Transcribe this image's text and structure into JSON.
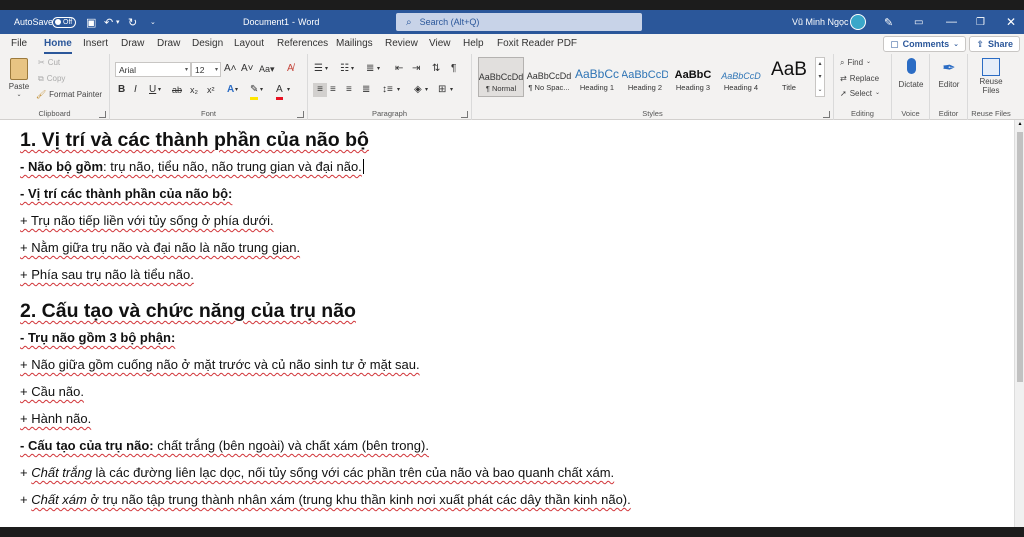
{
  "titlebar": {
    "autosave_label": "AutoSave",
    "autosave_state": "Off",
    "document_title": "Document1",
    "separator": "-",
    "app_name": "Word",
    "search_placeholder": "Search (Alt+Q)",
    "user_name": "Vũ Minh Ngọc"
  },
  "menu": {
    "tabs": [
      "File",
      "Home",
      "Insert",
      "Draw",
      "Draw",
      "Design",
      "Layout",
      "References",
      "Mailings",
      "Review",
      "View",
      "Help",
      "Foxit Reader PDF"
    ],
    "active": "Home",
    "comments_label": "Comments",
    "share_label": "Share"
  },
  "ribbon": {
    "clipboard": {
      "paste": "Paste",
      "cut": "Cut",
      "copy": "Copy",
      "format_painter": "Format Painter",
      "label": "Clipboard"
    },
    "font": {
      "name": "Arial",
      "size": "12",
      "case": "Aa",
      "label": "Font"
    },
    "paragraph": {
      "label": "Paragraph"
    },
    "styles": {
      "items": [
        {
          "sample": "AaBbCcDd",
          "name": "¶ Normal"
        },
        {
          "sample": "AaBbCcDd",
          "name": "¶ No Spac..."
        },
        {
          "sample": "AaBbCc",
          "name": "Heading 1"
        },
        {
          "sample": "AaBbCcD",
          "name": "Heading 2"
        },
        {
          "sample": "AaBbC",
          "name": "Heading 3"
        },
        {
          "sample": "AaBbCcD",
          "name": "Heading 4"
        },
        {
          "sample": "AaB",
          "name": "Title"
        }
      ],
      "label": "Styles"
    },
    "editing": {
      "find": "Find",
      "replace": "Replace",
      "select": "Select",
      "label": "Editing"
    },
    "voice": {
      "dictate": "Dictate",
      "label": "Voice"
    },
    "editor": {
      "editor": "Editor",
      "label": "Editor"
    },
    "reuse": {
      "line1": "Reuse",
      "line2": "Files",
      "label": "Reuse Files"
    }
  },
  "document": {
    "h1_a": "1. Vị trí và các thành phần của não bộ",
    "p1_lead": "- Não bộ gồm",
    "p1_rest": ": trụ não, tiểu não, não trung gian và đại não.",
    "p2": "- Vị trí các thành phần của não bộ:",
    "p3": "+ Trụ não tiếp liền với tủy sống ở phía dưới.",
    "p4": "+ Nằm giữa trụ não và đại não là não trung gian.",
    "p5": "+ Phía sau trụ não là tiểu não.",
    "h1_b": "2. Cấu tạo và chức năng của trụ não",
    "p6": "- Trụ não gồm 3 bộ phận:",
    "p7": "+ Não giữa gồm cuống não ở mặt trước và củ não sinh tư ở mặt sau.",
    "p8": "+ Cầu não.",
    "p9": "+ Hành não.",
    "p10_lead": "- Cấu tạo của trụ não:",
    "p10_rest": " chất trắng (bên ngoài) và chất xám (bên trong).",
    "p11_plus": "+ ",
    "p11_term": "Chất trắng",
    "p11_rest": " là các đường liên lạc dọc, nối tủy sống với các phần trên của não và bao quanh chất xám.",
    "p12_plus": "+ ",
    "p12_term": "Chất xám",
    "p12_rest": " ở trụ não tập trung thành nhân xám (trung khu thần kinh nơi xuất phát các dây thần kinh não)."
  }
}
